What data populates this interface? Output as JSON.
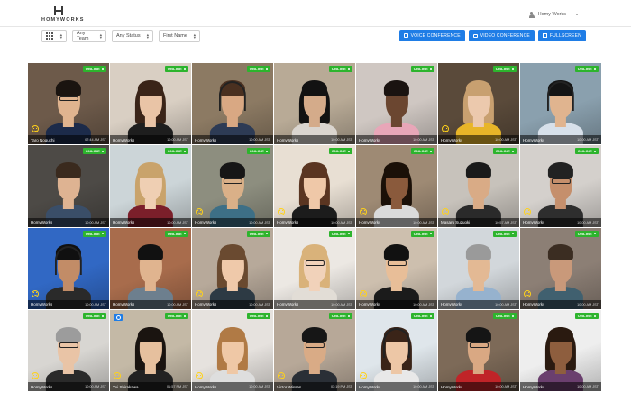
{
  "header": {
    "logo_text": "HOMYWORKS",
    "user_name": "Homy Works"
  },
  "toolbar": {
    "team_filter": "Any Team",
    "status_filter": "Any Status",
    "sort_by": "First Name",
    "voice_label": "VOICE CONFERENCE",
    "video_label": "VIDEO CONFERENCE",
    "fullscreen_label": "FULLSCREEN"
  },
  "status_label": "ONLINE",
  "colors": {
    "accent": "#1f7de6",
    "online": "#2db42d"
  },
  "tiles": [
    {
      "name": "Taro Noguchi",
      "time": "07:44 AM JST",
      "bg": "#6d5a4a",
      "skin": "#e0b48f",
      "hair": "#1a1410",
      "shirt": "#1c2b4a",
      "emoji": true,
      "glasses": true
    },
    {
      "name": "HomyWorks",
      "time": "10:00 AM JST",
      "bg": "#d9cfc3",
      "skin": "#e9c4a6",
      "hair": "#3a2418",
      "shirt": "#1e1e1e",
      "longhair": true
    },
    {
      "name": "HomyWorks",
      "time": "10:00 AM JST",
      "bg": "#8c7a63",
      "skin": "#d9a883",
      "hair": "#4a3020",
      "shirt": "#2d3b55",
      "headset": true
    },
    {
      "name": "HomyWorks",
      "time": "10:00 AM JST",
      "bg": "#b8aa96",
      "skin": "#d4ab8a",
      "hair": "#121212",
      "shirt": "#dad5cf",
      "longhair": true
    },
    {
      "name": "HomyWorks",
      "time": "10:00 AM JST",
      "bg": "#cfc7c2",
      "skin": "#6b4630",
      "hair": "#1a1310",
      "shirt": "#e8a6b8"
    },
    {
      "name": "HomyWorks",
      "time": "10:00 AM JST",
      "bg": "#5a4a3a",
      "skin": "#ecc9ad",
      "hair": "#c8a070",
      "shirt": "#e8b528",
      "emoji": true,
      "longhair": true
    },
    {
      "name": "HomyWorks",
      "time": "10:00 AM JST",
      "bg": "#8aa0ae",
      "skin": "#e0b48f",
      "hair": "#141414",
      "shirt": "#d7e0ea",
      "headset": true
    },
    {
      "name": "HomyWorks",
      "time": "10:00 AM JST",
      "bg": "#4d4a46",
      "skin": "#deb392",
      "hair": "#3a2a1e",
      "shirt": "#3a4e68"
    },
    {
      "name": "HomyWorks",
      "time": "10:00 AM JST",
      "bg": "#ccd5d8",
      "skin": "#efcfb3",
      "hair": "#c9a36b",
      "shirt": "#7b1f2a",
      "longhair": true
    },
    {
      "name": "HomyWorks",
      "time": "10:00 AM JST",
      "bg": "#8d8e7f",
      "skin": "#dab088",
      "hair": "#161616",
      "shirt": "#3d6f86",
      "emoji": true,
      "glasses": true
    },
    {
      "name": "HomyWorks",
      "time": "10:00 AM JST",
      "bg": "#e8dfd3",
      "skin": "#efc8a8",
      "hair": "#5a3521",
      "shirt": "#1c1c1c",
      "emoji": true,
      "longhair": true
    },
    {
      "name": "HomyWorks",
      "time": "10:00 AM JST",
      "bg": "#9e8a74",
      "skin": "#8a5a3c",
      "hair": "#1a1008",
      "shirt": "#dadada",
      "emoji": true,
      "longhair": true
    },
    {
      "name": "Masaru Suzuoki",
      "time": "10:57 AM JST",
      "bg": "#c7c2bb",
      "skin": "#d9ab86",
      "hair": "#1a1a1a",
      "shirt": "#2a2a2a",
      "emoji": true
    },
    {
      "name": "HomyWorks",
      "time": "10:00 AM JST",
      "bg": "#d4d0cc",
      "skin": "#c58f6c",
      "hair": "#222",
      "shirt": "#2e2e2e",
      "emoji": true,
      "glasses": true
    },
    {
      "name": "HomyWorks",
      "time": "10:00 AM JST",
      "bg": "#3168c4",
      "skin": "#c28c67",
      "hair": "#101010",
      "shirt": "#2a2a2a",
      "emoji": true,
      "headset": true
    },
    {
      "name": "HomyWorks",
      "time": "10:00 AM JST",
      "bg": "#a86c4c",
      "skin": "#e0b48f",
      "hair": "#111",
      "shirt": "#6d7f8e"
    },
    {
      "name": "HomyWorks",
      "time": "10:00 AM JST",
      "bg": "#b7a99a",
      "skin": "#efc9aa",
      "hair": "#6a4a30",
      "shirt": "#2d3a44",
      "emoji": true,
      "longhair": true
    },
    {
      "name": "HomyWorks",
      "time": "10:00 AM JST",
      "bg": "#ece8e3",
      "skin": "#f1d2ba",
      "hair": "#d9b27a",
      "shirt": "#e2ddd6",
      "longhair": true,
      "glasses": true
    },
    {
      "name": "HomyWorks",
      "time": "10:00 AM JST",
      "bg": "#cdbfae",
      "skin": "#e8be98",
      "hair": "#111",
      "shirt": "#1b1b1b",
      "emoji": true,
      "glasses": true
    },
    {
      "name": "HomyWorks",
      "time": "10:00 AM JST",
      "bg": "#d2d7db",
      "skin": "#e3b994",
      "hair": "#9a9a9a",
      "shirt": "#96b2ce"
    },
    {
      "name": "HomyWorks",
      "time": "10:00 AM JST",
      "bg": "#8c7f75",
      "skin": "#c9997a",
      "hair": "#3b2d22",
      "shirt": "#40606f",
      "emoji": true
    },
    {
      "name": "HomyWorks",
      "time": "10:00 AM JST",
      "bg": "#d8d6d2",
      "skin": "#e9c4a6",
      "hair": "#9c9c9c",
      "shirt": "#2a2a2a",
      "emoji": true,
      "glasses": true
    },
    {
      "name": "Yui Shirakawa",
      "time": "01:57 PM JST",
      "bg": "#c4b9a6",
      "skin": "#e6c09e",
      "hair": "#1a1410",
      "shirt": "#222",
      "emoji": true,
      "camera": true,
      "longhair": true
    },
    {
      "name": "HomyWorks",
      "time": "10:00 AM JST",
      "bg": "#e6e2de",
      "skin": "#efc8a6",
      "hair": "#b07a45",
      "shirt": "#dedede",
      "emoji": true,
      "longhair": true
    },
    {
      "name": "Victor Wissan",
      "time": "03:19 PM JST",
      "bg": "#b7a898",
      "skin": "#d9ab86",
      "hair": "#161616",
      "shirt": "#2a2f36",
      "emoji": true,
      "glasses": true
    },
    {
      "name": "HomyWorks",
      "time": "10:00 AM JST",
      "bg": "#dfe6eb",
      "skin": "#edc7a6",
      "hair": "#3a2418",
      "shirt": "#e8e8e8",
      "emoji": true,
      "headset": true,
      "longhair": true
    },
    {
      "name": "HomyWorks",
      "time": "10:00 AM JST",
      "bg": "#7d6a58",
      "skin": "#d9a883",
      "hair": "#151515",
      "shirt": "#c02428",
      "glasses": true
    },
    {
      "name": "HomyWorks",
      "time": "10:00 AM JST",
      "bg": "#eeeeee",
      "skin": "#8e5e3e",
      "hair": "#2a1a10",
      "shirt": "#6a3f6e",
      "longhair": true
    }
  ]
}
